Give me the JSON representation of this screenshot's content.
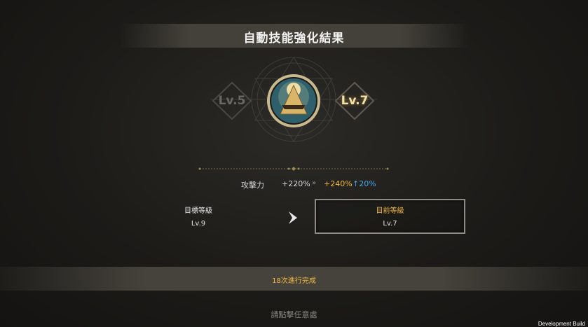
{
  "header": {
    "title": "自動技能強化結果"
  },
  "skill": {
    "icon": "pyramid-eye-skill-icon",
    "level_from": "Lv.5",
    "level_to": "Lv.7"
  },
  "stat": {
    "label": "攻擊力",
    "old_value": "+220%",
    "arrow": "»",
    "new_value": "+240%",
    "increase": "↑20%"
  },
  "levels": {
    "target_label": "目標等級",
    "target_value": "Lv.9",
    "current_label": "目前等級",
    "current_value": "Lv.7"
  },
  "result": {
    "status": "18次進行完成"
  },
  "footer": {
    "prompt": "請點擊任意處",
    "build_label": "Development Build"
  },
  "colors": {
    "accent_gold": "#f0b840",
    "increase_blue": "#4aa8e8",
    "level_highlight": "#f3e1a3"
  }
}
